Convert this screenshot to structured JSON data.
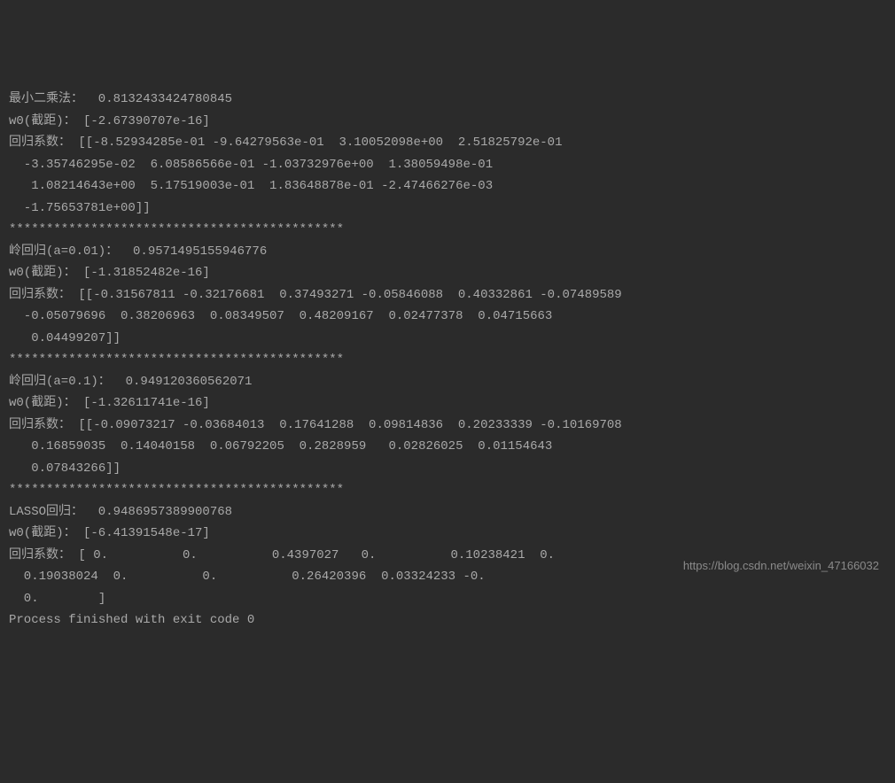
{
  "console": {
    "lines": [
      "最小二乘法：  0.8132433424780845",
      "w0(截距)： [-2.67390707e-16]",
      "回归系数： [[-8.52934285e-01 -9.64279563e-01  3.10052098e+00  2.51825792e-01",
      "  -3.35746295e-02  6.08586566e-01 -1.03732976e+00  1.38059498e-01",
      "   1.08214643e+00  5.17519003e-01  1.83648878e-01 -2.47466276e-03",
      "  -1.75653781e+00]]",
      "*********************************************",
      "岭回归(a=0.01)：  0.9571495155946776",
      "w0(截距)： [-1.31852482e-16]",
      "回归系数： [[-0.31567811 -0.32176681  0.37493271 -0.05846088  0.40332861 -0.07489589",
      "  -0.05079696  0.38206963  0.08349507  0.48209167  0.02477378  0.04715663",
      "   0.04499207]]",
      "*********************************************",
      "岭回归(a=0.1)：  0.949120360562071",
      "w0(截距)： [-1.32611741e-16]",
      "回归系数： [[-0.09073217 -0.03684013  0.17641288  0.09814836  0.20233339 -0.10169708",
      "   0.16859035  0.14040158  0.06792205  0.2828959   0.02826025  0.01154643",
      "   0.07843266]]",
      "*********************************************",
      "LASSO回归：  0.9486957389900768",
      "w0(截距)： [-6.41391548e-17]",
      "回归系数： [ 0.          0.          0.4397027   0.          0.10238421  0.",
      "  0.19038024  0.          0.          0.26420396  0.03324233 -0.",
      "  0.        ]",
      "",
      "Process finished with exit code 0"
    ]
  },
  "watermark": "https://blog.csdn.net/weixin_47166032"
}
